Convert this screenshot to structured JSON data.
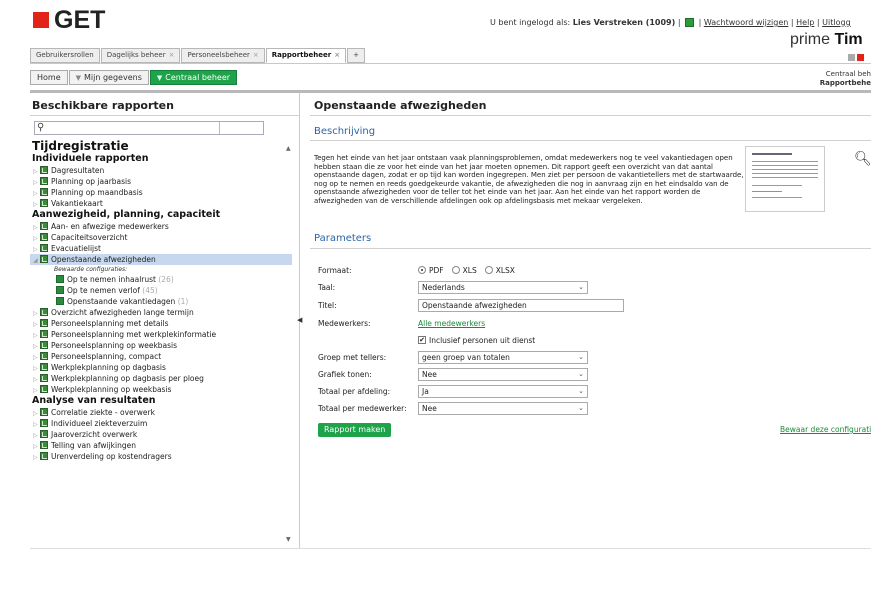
{
  "app": {
    "logo_text": "GET",
    "brand_prefix": "prime ",
    "brand_bold": "Tim",
    "logo_color": "#e2231a",
    "accent": "#1fa34a"
  },
  "user": {
    "prefix": "U bent ingelogd als: ",
    "name": "Lies Verstreken (1009)",
    "sep1": " | ",
    "sep2": " | ",
    "change_password": "Wachtwoord wijzigen",
    "sep3": " | ",
    "help": "Help",
    "sep4": " | ",
    "logout": "Uitlogg"
  },
  "tabs": [
    {
      "label": "Gebruikersrollen",
      "close": ""
    },
    {
      "label": "Dagelijks beheer",
      "close": "×"
    },
    {
      "label": "Personeelsbeheer",
      "close": "×"
    },
    {
      "label": "Rapportbeheer",
      "close": "×"
    },
    {
      "label": "+",
      "close": ""
    }
  ],
  "nav": {
    "home": "Home",
    "my_data": "Mijn gegevens",
    "central": "Centraal beheer"
  },
  "context": {
    "line1": "Centraal beh",
    "line2": "Rapportbehe"
  },
  "left": {
    "title": "Beschikbare rapporten",
    "search_placeholder": "",
    "group1": "Tijdregistratie",
    "sub1": "Individuele rapporten",
    "sub1_items": [
      "Dagresultaten",
      "Planning op jaarbasis",
      "Planning op maandbasis",
      "Vakantiekaart"
    ],
    "sub2": "Aanwezigheid, planning, capaciteit",
    "sub2_items_a": [
      "Aan- en afwezige medewerkers",
      "Capaciteitsoverzicht",
      "Evacuatielijst"
    ],
    "selected": "Openstaande afwezigheden",
    "cfg_header": "Bewaarde configuraties:",
    "configs": [
      {
        "label": "Op te nemen inhaalrust",
        "count": "(26)"
      },
      {
        "label": "Op te nemen verlof",
        "count": "(45)"
      },
      {
        "label": "Openstaande vakantiedagen",
        "count": "(1)"
      }
    ],
    "sub2_items_b": [
      "Overzicht afwezigheden lange termijn",
      "Personeelsplanning met details",
      "Personeelsplanning met werkplekinformatie",
      "Personeelsplanning op weekbasis",
      "Personeelsplanning, compact",
      "Werkplekplanning op dagbasis",
      "Werkplekplanning op dagbasis per ploeg",
      "Werkplekplanning op weekbasis"
    ],
    "sub3": "Analyse van resultaten",
    "sub3_items": [
      "Correlatie ziekte - overwerk",
      "Individueel ziekteverzuim",
      "Jaaroverzicht overwerk",
      "Telling van afwijkingen",
      "Urenverdeling op kostendragers"
    ]
  },
  "right": {
    "title": "Openstaande afwezigheden",
    "desc_heading": "Beschrijving",
    "description": "Tegen het einde van het jaar ontstaan vaak planningsproblemen, omdat medewerkers nog te veel vakantiedagen open hebben staan die ze voor het einde van het jaar moeten opnemen. Dit rapport geeft een overzicht van dat aantal openstaande dagen, zodat er op tijd kan worden ingegrepen. Men ziet per persoon de vakantietellers met de startwaarde, nog op te nemen en reeds goedgekeurde vakantie, de afwezigheden die nog in aanvraag zijn en het eindsaldo van de openstaande afwezigheden voor de teller tot het einde van het jaar. Aan het einde van het rapport worden de afwezigheden van de verschillende afdelingen ook op afdelingsbasis met mekaar vergeleken.",
    "params_heading": "Parameters",
    "format_label": "Formaat:",
    "formats": [
      "PDF",
      "XLS",
      "XLSX"
    ],
    "format_selected": "PDF",
    "lang_label": "Taal:",
    "lang_value": "Nederlands",
    "title_label": "Titel:",
    "title_value": "Openstaande afwezigheden",
    "emp_label": "Medewerkers:",
    "emp_link": "Alle medewerkers",
    "incl_label": "Inclusief personen uit dienst",
    "incl_checked": true,
    "group_label": "Groep met tellers:",
    "group_value": "geen groep van totalen",
    "graph_label": "Grafiek tonen:",
    "graph_value": "Nee",
    "dept_label": "Totaal per afdeling:",
    "dept_value": "Ja",
    "empt_label": "Totaal per medewerker:",
    "empt_value": "Nee",
    "run_button": "Rapport maken",
    "save_config": "Bewaar deze configurati"
  }
}
